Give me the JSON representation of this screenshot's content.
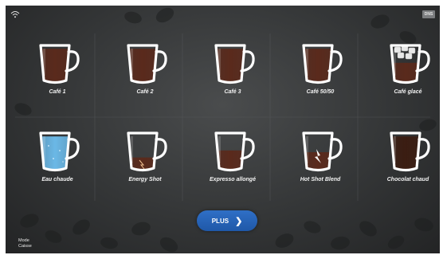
{
  "status": {
    "wifi_icon": "wifi-icon",
    "language": "DNS"
  },
  "drinks": [
    {
      "label": "Café 1",
      "fill": "coffee"
    },
    {
      "label": "Café 2",
      "fill": "coffee"
    },
    {
      "label": "Café 3",
      "fill": "coffee"
    },
    {
      "label": "Café 50/50",
      "fill": "coffee"
    },
    {
      "label": "Café glacé",
      "fill": "iced"
    },
    {
      "label": "Eau chaude",
      "fill": "water"
    },
    {
      "label": "Energy Shot",
      "fill": "shot"
    },
    {
      "label": "Expresso allongé",
      "fill": "half"
    },
    {
      "label": "Hot Shot Blend",
      "fill": "blend"
    },
    {
      "label": "Chocolat chaud",
      "fill": "chocolate"
    }
  ],
  "plus_button": {
    "label": "PLUS",
    "icon": "chevron-right-icon"
  },
  "mode": {
    "line1": "Mode",
    "line2": "Caisse"
  },
  "colors": {
    "coffee": "#5a2a1c",
    "water": "#6bb8e6",
    "chocolate": "#3b1d12",
    "button": "#2a67bd",
    "background": "#363839"
  }
}
